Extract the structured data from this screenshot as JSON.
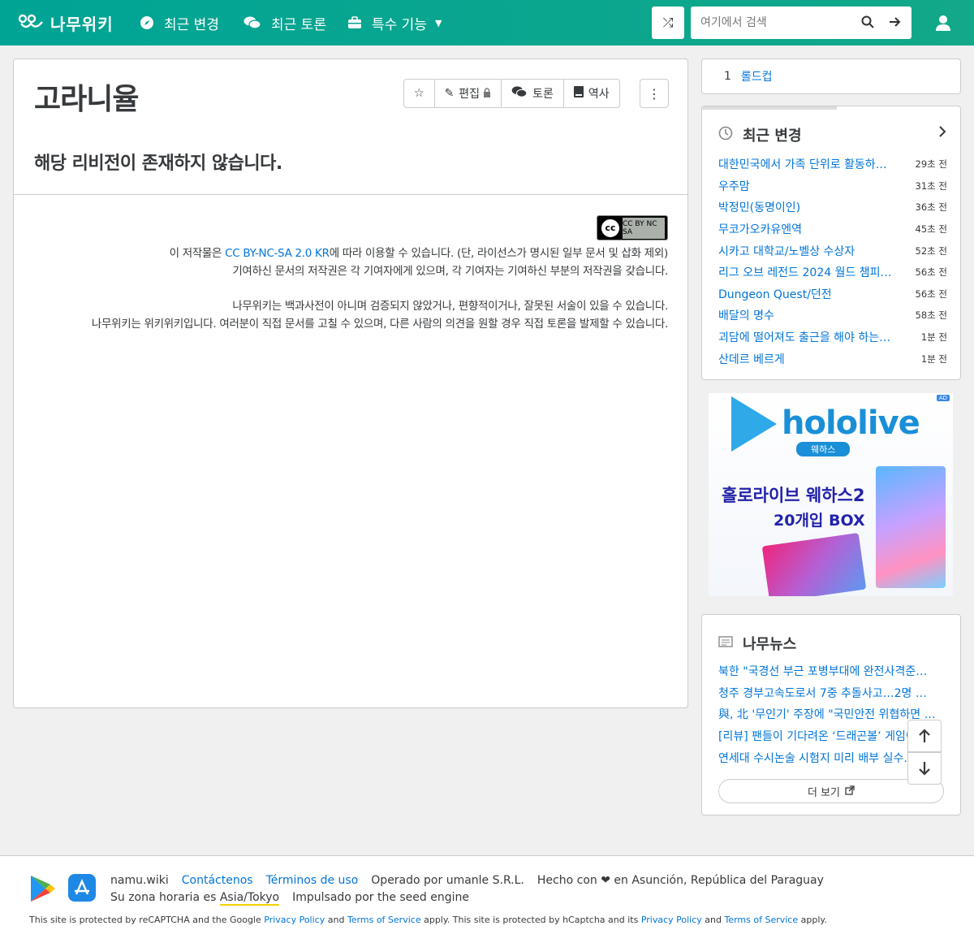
{
  "header": {
    "logo_text": "나무위키",
    "nav": [
      {
        "label": "최근 변경",
        "icon": "compass-icon"
      },
      {
        "label": "최근 토론",
        "icon": "comments-icon"
      },
      {
        "label": "특수 기능",
        "icon": "toolbox-icon"
      }
    ],
    "search_placeholder": "여기에서 검색"
  },
  "document": {
    "title": "고라니율",
    "toolbar": {
      "star_icon": "star-icon",
      "edit_label": "편집",
      "discuss_label": "토론",
      "history_label": "역사"
    },
    "message": "해당 리비전이 존재하지 않습니다.",
    "license_badge": "CC BY NC SA",
    "license": {
      "line1_prefix": "이 저작물은 ",
      "line1_link": "CC BY-NC-SA 2.0 KR",
      "line1_suffix": "에 따라 이용할 수 있습니다. (단, 라이선스가 명시된 일부 문서 및 삽화 제외)",
      "line2": "기여하신 문서의 저작권은 각 기여자에게 있으며, 각 기여자는 기여하신 부분의 저작권을 갖습니다.",
      "line3": "나무위키는 백과사전이 아니며 검증되지 않았거나, 편향적이거나, 잘못된 서술이 있을 수 있습니다.",
      "line4": "나무위키는 위키위키입니다. 여러분이 직접 문서를 고칠 수 있으며, 다른 사람의 의견을 원할 경우 직접 토론을 발제할 수 있습니다."
    }
  },
  "toc": {
    "num": "1",
    "label": "롤드컵"
  },
  "recent_changes": {
    "title": "최근 변경",
    "items": [
      {
        "title": "대한민국에서 가족 단위로 활동하…",
        "time": "29초 전"
      },
      {
        "title": "우주맘",
        "time": "31초 전"
      },
      {
        "title": "박정민(동명이인)",
        "time": "36초 전"
      },
      {
        "title": "무코가오카유엔역",
        "time": "45초 전"
      },
      {
        "title": "시카고 대학교/노벨상 수상자",
        "time": "52초 전"
      },
      {
        "title": "리그 오브 레전드 2024 월드 챔피…",
        "time": "56초 전"
      },
      {
        "title": "Dungeon Quest/던전",
        "time": "56초 전"
      },
      {
        "title": "배달의 명수",
        "time": "58초 전"
      },
      {
        "title": "괴담에 떨어져도 출근을 해야 하는…",
        "time": "1분 전"
      },
      {
        "title": "산데르 베르게",
        "time": "1분 전"
      }
    ]
  },
  "ad": {
    "tag": "AD",
    "brand": "hololive",
    "sub": "웨하스",
    "promo_line1": "홀로라이브 웨하스2",
    "promo_line2": "20개입 BOX"
  },
  "news": {
    "title": "나무뉴스",
    "items": [
      "북한 \"국경선 부근 포병부대에 완전사격준…",
      "청주 경부고속도로서 7중 추돌사고…2명 …",
      "與, 北 '무인기' 주장에 \"국민안전 위협하면 …",
      "[리뷰] 팬들이 기다려온 ‘드래곤볼’ 게임이…",
      "연세대 수시논술 시험지 미리 배부 실수…"
    ],
    "more_label": "더 보기"
  },
  "footer": {
    "line1": [
      "namu.wiki",
      "Contáctenos",
      "Términos de uso",
      "Operado por umanle S.R.L.",
      "Hecho con ❤ en Asunción, República del Paraguay"
    ],
    "tz_prefix": "Su zona horaria es ",
    "tz_value": "Asia/Tokyo",
    "engine": "Impulsado por the seed engine",
    "captcha": {
      "p1": "This site is protected by reCAPTCHA and the Google ",
      "l1": "Privacy Policy",
      "p2": " and ",
      "l2": "Terms of Service",
      "p3": " apply. This site is protected by hCaptcha and its ",
      "l3": "Privacy Policy",
      "p4": " and ",
      "l4": "Terms of Service",
      "p5": " apply."
    }
  },
  "colors": {
    "brand": "#00a495",
    "link": "#0275d8"
  }
}
